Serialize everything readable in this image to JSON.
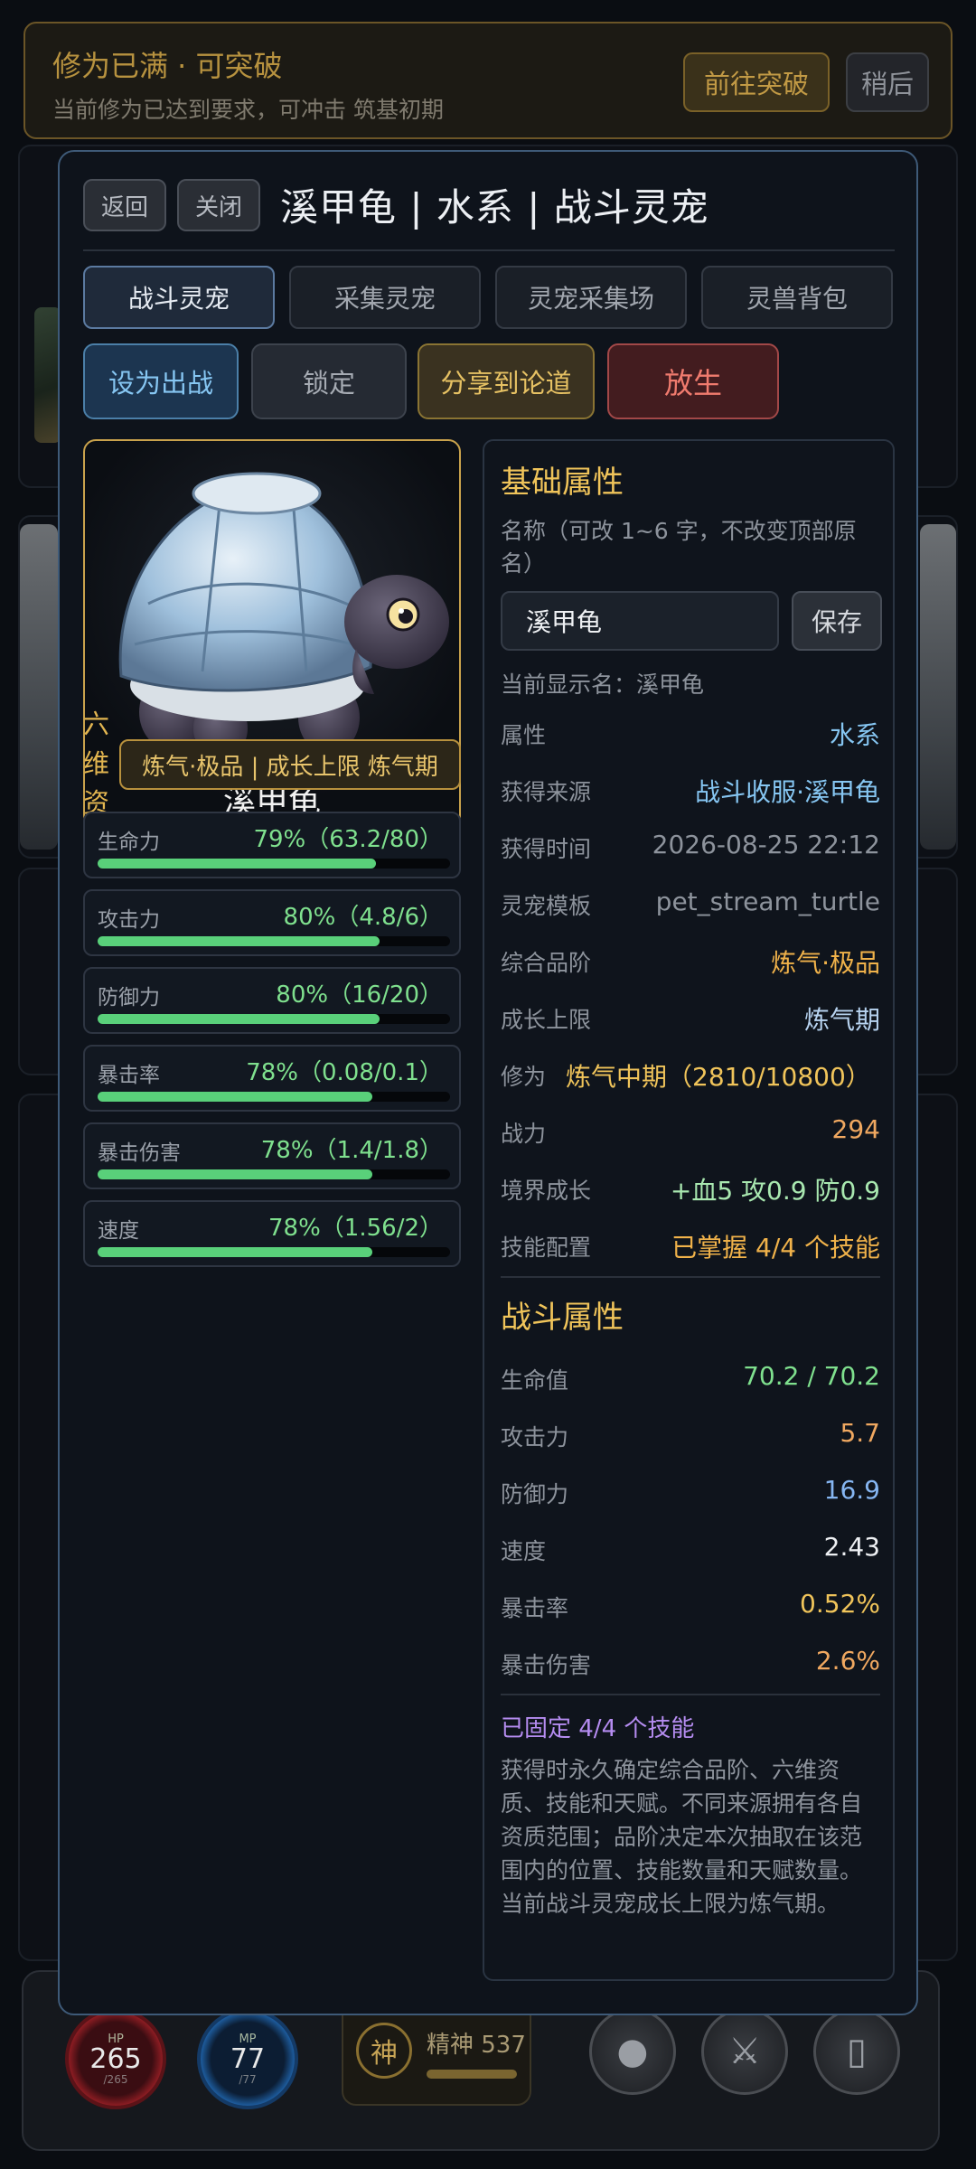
{
  "colors": {
    "gold": "#f0c45a",
    "green": "#7fe08e",
    "water_blue": "#86c6f2",
    "orange": "#f0a860",
    "red": "#f07b6e",
    "purple": "#b58cf0"
  },
  "banner": {
    "title": "修为已满 · 可突破",
    "subtitle": "当前修为已达到要求，可冲击 筑基初期",
    "go_label": "前往突破",
    "later_label": "稍后"
  },
  "modal": {
    "back_label": "返回",
    "close_label": "关闭",
    "title": "溪甲龟 | 水系 | 战斗灵宠",
    "tabs": [
      {
        "label": "战斗灵宠",
        "active": true
      },
      {
        "label": "采集灵宠",
        "active": false
      },
      {
        "label": "灵宠采集场",
        "active": false
      },
      {
        "label": "灵兽背包",
        "active": false
      }
    ],
    "actions": {
      "deploy": "设为出战",
      "lock": "锁定",
      "share": "分享到论道",
      "release": "放生"
    }
  },
  "pet": {
    "portrait_name": "溪甲龟",
    "aptitude_label": "六维资质",
    "aptitude_badge": "炼气·极品 | 成长上限 炼气期",
    "stats": [
      {
        "name": "生命力",
        "value": "79%（63.2/80）",
        "pct": 79
      },
      {
        "name": "攻击力",
        "value": "80%（4.8/6）",
        "pct": 80
      },
      {
        "name": "防御力",
        "value": "80%（16/20）",
        "pct": 80
      },
      {
        "name": "暴击率",
        "value": "78%（0.08/0.1）",
        "pct": 78
      },
      {
        "name": "暴击伤害",
        "value": "78%（1.4/1.8）",
        "pct": 78
      },
      {
        "name": "速度",
        "value": "78%（1.56/2）",
        "pct": 78
      }
    ]
  },
  "basic": {
    "title": "基础属性",
    "name_hint": "名称（可改 1~6 字，不改变顶部原名）",
    "name_value": "溪甲龟",
    "save_label": "保存",
    "current_name": "当前显示名：溪甲龟",
    "rows": [
      {
        "key": "属性",
        "value": "水系"
      },
      {
        "key": "获得来源",
        "value": "战斗收服·溪甲龟"
      },
      {
        "key": "获得时间",
        "value": "2026-08-25 22:12"
      },
      {
        "key": "灵宠模板",
        "value": "pet_stream_turtle"
      },
      {
        "key": "综合品阶",
        "value": "炼气·极品"
      },
      {
        "key": "成长上限",
        "value": "炼气期"
      },
      {
        "key": "修为",
        "value": "炼气中期（2810/10800）"
      },
      {
        "key": "战力",
        "value": "294"
      },
      {
        "key": "境界成长",
        "value": "+血5 攻0.9 防0.9"
      },
      {
        "key": "技能配置",
        "value": "已掌握 4/4 个技能"
      }
    ]
  },
  "combat": {
    "title": "战斗属性",
    "rows": [
      {
        "key": "生命值",
        "value": "70.2 / 70.2"
      },
      {
        "key": "攻击力",
        "value": "5.7"
      },
      {
        "key": "防御力",
        "value": "16.9"
      },
      {
        "key": "速度",
        "value": "2.43"
      },
      {
        "key": "暴击率",
        "value": "0.52%"
      },
      {
        "key": "暴击伤害",
        "value": "2.6%"
      }
    ],
    "skills_fixed": "已固定 4/4 个技能",
    "description": "获得时永久确定综合品阶、六维资质、技能和天赋。不同来源拥有各自资质范围；品阶决定本次抽取在该范围内的位置、技能数量和天赋数量。当前战斗灵宠成长上限为炼气期。"
  },
  "hud": {
    "hp_label": "HP",
    "hp_value": "265",
    "hp_sub": "/265",
    "mp_label": "MP",
    "mp_value": "77",
    "mp_sub": "/77",
    "spirit_char": "神",
    "spirit_label": "精神 537",
    "spirit_pct": 100
  }
}
